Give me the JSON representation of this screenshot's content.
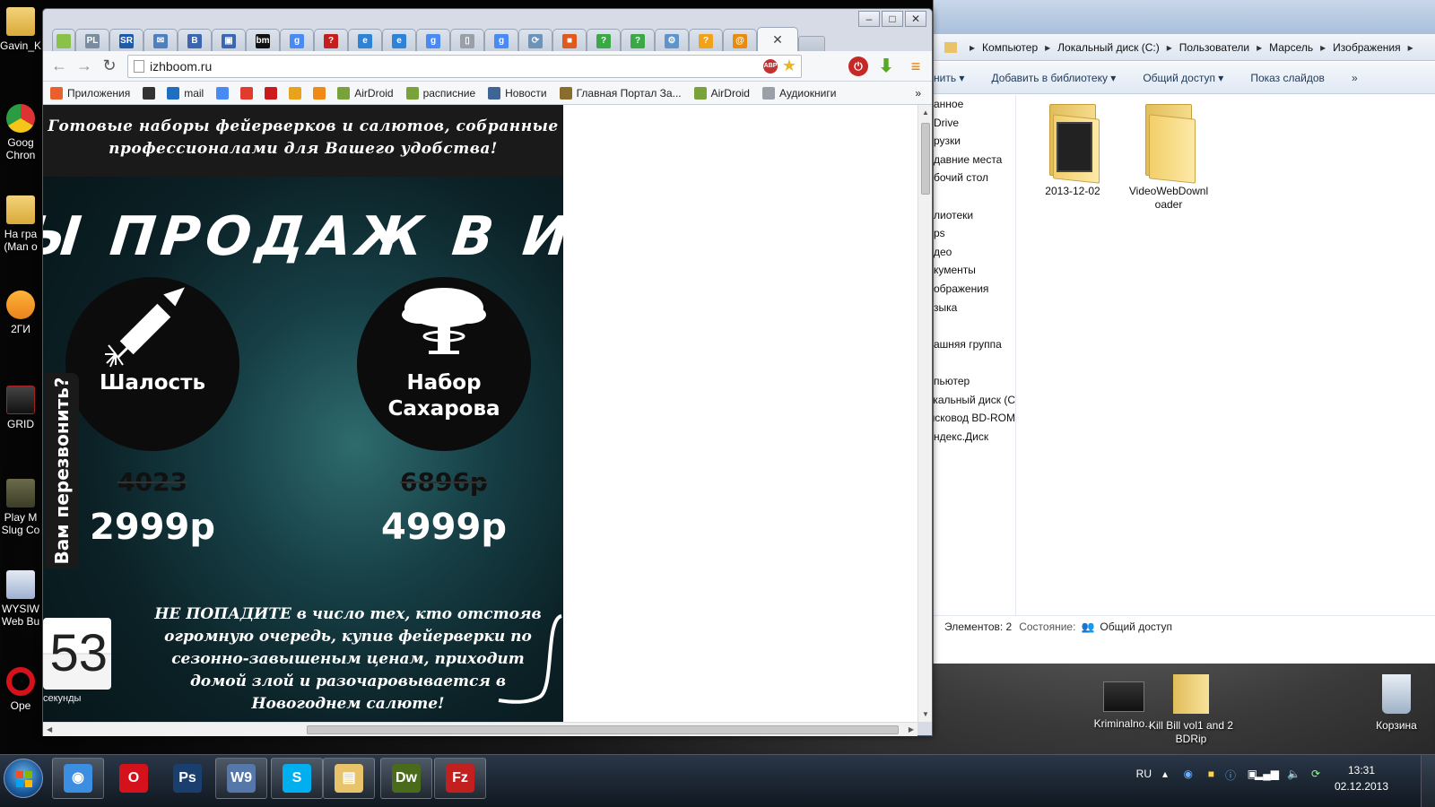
{
  "desktop": {
    "left_icons": [
      "Gavin_K",
      "Goog Chron",
      "На гра (Man o",
      "2ГИ",
      "GRID",
      "Play M Slug Co",
      "WYSIW Web Bu",
      "Ope"
    ],
    "right_icons": [
      "Kriminalno...",
      "Kill Bill vol1 and 2 BDRip",
      "Корзина"
    ]
  },
  "browser": {
    "url": "izhboom.ru",
    "tab_favicons": [
      "PL",
      "SR",
      "✉",
      "B",
      "▣",
      "bm",
      "g",
      "?",
      "e",
      "e",
      "g",
      "▯",
      "g",
      "⟳",
      "■",
      "?",
      "?",
      "⚙",
      "?",
      "@"
    ],
    "tab_colors": [
      "#7b8c9e",
      "#1e5aa8",
      "#4f7fbf",
      "#3b66b0",
      "#3b66b0",
      "#111111",
      "#4a8af4",
      "#c41e1e",
      "#2f83d6",
      "#2f83d6",
      "#4a8af4",
      "#9aa0a8",
      "#4a8af4",
      "#6d93b8",
      "#e0591f",
      "#3aa845",
      "#3aa845",
      "#5f93c9",
      "#f0a21b",
      "#e88b0f"
    ],
    "bookmarks": [
      {
        "label": "Приложения",
        "icon": "apps-icon",
        "color": "#e8612c"
      },
      {
        "label": "",
        "icon": "gamepad-icon",
        "color": "#333333"
      },
      {
        "label": "mail",
        "icon": "mail-at-icon",
        "color": "#1f6fc1"
      },
      {
        "label": "",
        "icon": "google-icon",
        "color": "#4a8af4"
      },
      {
        "label": "",
        "icon": "yandex-icon",
        "color": "#e23a2e"
      },
      {
        "label": "",
        "icon": "youtube-icon",
        "color": "#cc1b1b"
      },
      {
        "label": "",
        "icon": "rbc-icon",
        "color": "#e8a21b"
      },
      {
        "label": "",
        "icon": "odnoklassniki-icon",
        "color": "#f08a16"
      },
      {
        "label": "AirDroid",
        "icon": "airdroid-icon",
        "color": "#79a23a"
      },
      {
        "label": "расписние",
        "icon": "airdroid-icon",
        "color": "#79a23a"
      },
      {
        "label": "Новости",
        "icon": "vk-icon",
        "color": "#3e6595"
      },
      {
        "label": "Главная Портал За...",
        "icon": "emblem-icon",
        "color": "#8a6d2b"
      },
      {
        "label": "AirDroid",
        "icon": "airdroid-icon",
        "color": "#79a23a"
      },
      {
        "label": "Аудиокниги",
        "icon": "page-icon",
        "color": "#9aa0a8"
      }
    ],
    "more": "»"
  },
  "site": {
    "header": "Готовые наборы фейерверков и салютов, собранные профессионалами для Вашего удобства!",
    "banner": "Ы ПРОДАЖ В ИЖЕ",
    "products": [
      {
        "name": "Шалость",
        "old_price": "4023",
        "new_price": "2999р",
        "icon": "rocket-icon"
      },
      {
        "name": "Набор Сахарова",
        "old_price": "6896р",
        "new_price": "4999р",
        "icon": "mushroom-cloud-icon"
      }
    ],
    "callback": "Вам перезвонить?",
    "timer_value": "53",
    "timer_label": "секунды",
    "warning": "НЕ ПОПАДИТЕ в число тех, кто отстояв огромную очередь, купив фейерверки по сезонно-завышеным ценам, приходит домой злой и разочаровывается в Новогоднем салюте!"
  },
  "explorer": {
    "breadcrumb": [
      "Компьютер",
      "Локальный диск (C:)",
      "Пользователи",
      "Марсель",
      "Изображения"
    ],
    "toolbar": [
      "нить ▾",
      "Добавить в библиотеку ▾",
      "Общий доступ ▾",
      "Показ слайдов",
      "»"
    ],
    "nav": [
      "анное",
      "Drive",
      "рузки",
      "давние места",
      "бочий стол",
      "",
      "лиотеки",
      "ps",
      "део",
      "кументы",
      "ображения",
      "зыка",
      "",
      "ашняя группа",
      "",
      "пьютер",
      "кальный диск (С",
      "исковод BD-ROM",
      "ндекс.Диск"
    ],
    "folders": [
      "2013-12-02",
      "VideoWebDownl oader"
    ],
    "status_items": "Элементов: 2",
    "status_state_label": "Состояние:",
    "status_state": "Общий доступ"
  },
  "taskbar": {
    "apps": [
      {
        "name": "Chrome",
        "glyph": "◉",
        "color": "#3b8ee0",
        "open": true
      },
      {
        "name": "Opera",
        "glyph": "O",
        "color": "#d5121b",
        "open": false
      },
      {
        "name": "Photoshop",
        "glyph": "Ps",
        "color": "#1a3f6e",
        "open": false
      },
      {
        "name": "WYSIWYG",
        "glyph": "W9",
        "color": "#5577aa",
        "open": true
      },
      {
        "name": "Skype",
        "glyph": "S",
        "color": "#00aff0",
        "open": true
      },
      {
        "name": "Explorer",
        "glyph": "▤",
        "color": "#e8c36a",
        "open": true
      },
      {
        "name": "Dreamweaver",
        "glyph": "Dw",
        "color": "#4a6b1b",
        "open": true
      },
      {
        "name": "FileZilla",
        "glyph": "Fz",
        "color": "#c21f1f",
        "open": true
      }
    ],
    "lang": "RU",
    "time": "13:31",
    "date": "02.12.2013"
  }
}
